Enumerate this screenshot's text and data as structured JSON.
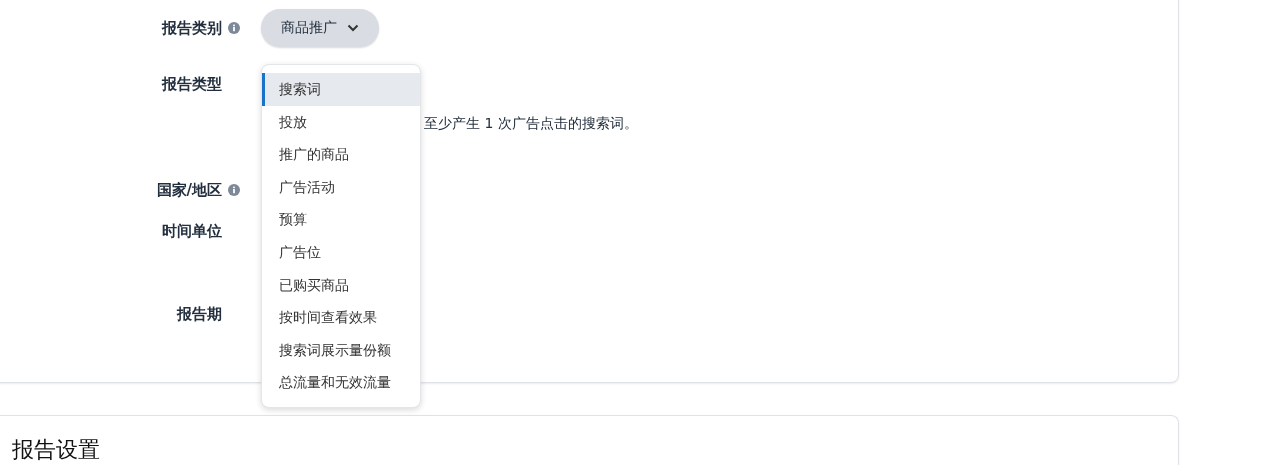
{
  "report_form": {
    "fields": [
      {
        "kind": "select",
        "label": "报告类别",
        "info": true,
        "value": "商品推广"
      },
      {
        "kind": "menu",
        "label": "报告类型",
        "info": false,
        "description": "至少产生 1 次广告点击的搜索词。"
      },
      {
        "kind": "plain",
        "label": "国家/地区",
        "info": true
      },
      {
        "kind": "plain",
        "label": "时间单位",
        "info": false
      },
      {
        "kind": "plain",
        "label": "报告期",
        "info": false
      }
    ],
    "report_type_menu": [
      {
        "label": "搜索词",
        "selected": true
      },
      {
        "label": "投放",
        "selected": false
      },
      {
        "label": "推广的商品",
        "selected": false
      },
      {
        "label": "广告活动",
        "selected": false
      },
      {
        "label": "预算",
        "selected": false
      },
      {
        "label": "广告位",
        "selected": false
      },
      {
        "label": "已购买商品",
        "selected": false
      },
      {
        "label": "按时间查看效果",
        "selected": false
      },
      {
        "label": "搜索词展示量份额",
        "selected": false
      },
      {
        "label": "总流量和无效流量",
        "selected": false
      }
    ]
  },
  "report_settings": {
    "title": "报告设置"
  }
}
